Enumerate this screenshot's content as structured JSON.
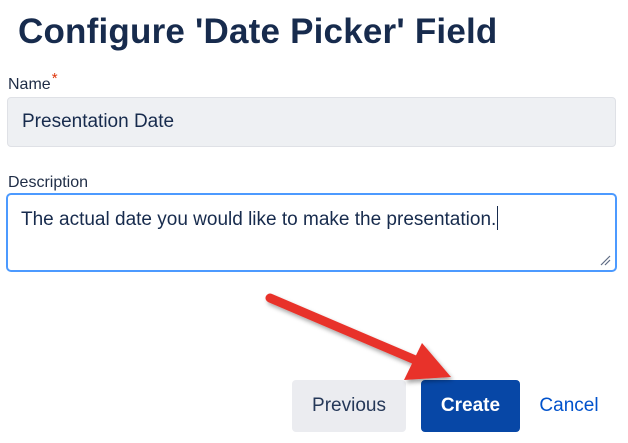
{
  "dialog": {
    "title": "Configure 'Date Picker' Field"
  },
  "fields": {
    "name": {
      "label": "Name",
      "required_mark": "*",
      "value": "Presentation Date"
    },
    "description": {
      "label": "Description",
      "value": "The actual date you would like to make the presentation."
    }
  },
  "buttons": {
    "previous": "Previous",
    "create": "Create",
    "cancel": "Cancel"
  },
  "colors": {
    "title_text": "#172b4d",
    "required_mark": "#de350b",
    "focus_border": "#4c9aff",
    "create_button": "#0747a6",
    "cancel_link": "#0052cc",
    "annotation_arrow": "#e8322a"
  },
  "icons": {
    "resize": "resize-handle-icon",
    "annotation": "red-arrow-annotation"
  }
}
